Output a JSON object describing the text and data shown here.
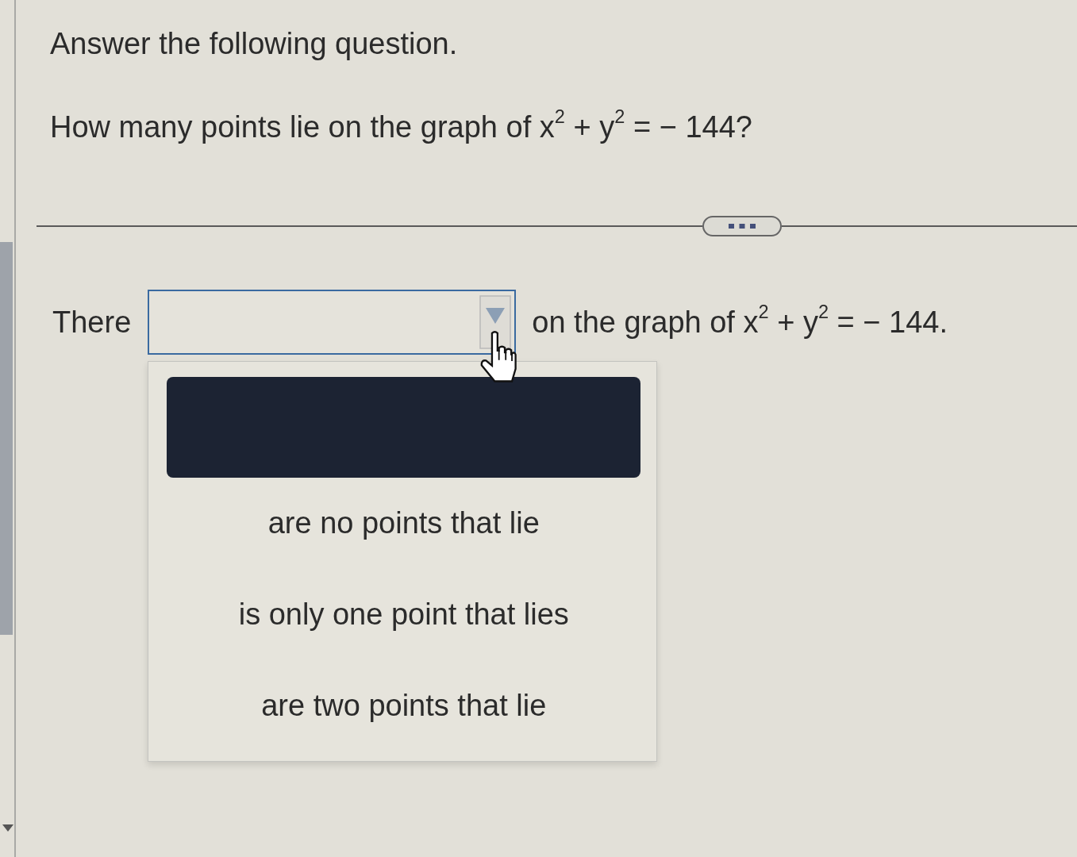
{
  "instruction": "Answer the following question.",
  "question": "How many points lie on the graph of x$^{2}$ + y$^{2}$ = − 144?",
  "answer": {
    "before": "There",
    "dropdown": {
      "expanded": true,
      "options": [
        {
          "selected": true
        },
        {
          "label": "are no points that lie",
          "selected": false
        },
        {
          "label": "is only one point that lies",
          "selected": false
        },
        {
          "label": "are two points that lie",
          "selected": false
        }
      ]
    },
    "after": "on the graph of x$^{2}$ + y$^{2}$ = − 144."
  }
}
